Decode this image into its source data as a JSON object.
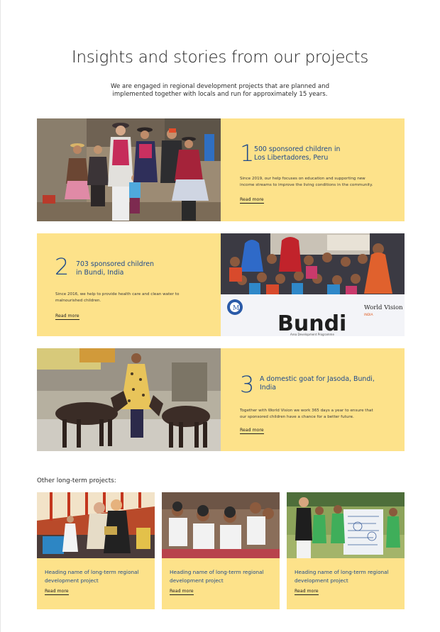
{
  "header": {
    "title": "Insights and stories from our projects",
    "intro_line1": "We are engaged in regional development projects that are planned and",
    "intro_line2": "implemented together with locals and run for approximately 15 years."
  },
  "features": [
    {
      "number": "1",
      "title_line1": "500 sponsored children in",
      "title_line2": "Los Libertadores, Peru",
      "desc_line1": "Since 2019, our help focuses on education and supporting new",
      "desc_line2": "income streams to improve the living conditions in the community.",
      "link": "Read more"
    },
    {
      "number": "2",
      "title_line1": "703 sponsored children",
      "title_line2": "in Bundi, India",
      "desc_line1": "Since 2016, we help to provide health care and clean water to",
      "desc_line2": "malnourished children.",
      "link": "Read more",
      "banner_text": "Bundi",
      "banner_sub": "Area Development Programme",
      "banner_brand": "World Vision",
      "banner_country": "INDIA"
    },
    {
      "number": "3",
      "title_line1": "A domestic goat for Jasoda, Bundi,",
      "title_line2": "India",
      "desc_line1": "Together with World Vision we work 365 days a year to ensure that",
      "desc_line2": "our sponsored children have a chance for a better future.",
      "link": "Read more"
    }
  ],
  "other": {
    "heading": "Other long-term projects:",
    "cards": [
      {
        "title_line1": "Heading name of long-term regional",
        "title_line2": "development project",
        "link": "Read more"
      },
      {
        "title_line1": "Heading name of long-term regional",
        "title_line2": "development project",
        "link": "Read more"
      },
      {
        "title_line1": "Heading name of long-term regional",
        "title_line2": "development project",
        "link": "Read more"
      }
    ]
  },
  "colors": {
    "panel": "#fde28a",
    "accent_blue": "#1f4a8a",
    "text": "#2b2b2b"
  }
}
